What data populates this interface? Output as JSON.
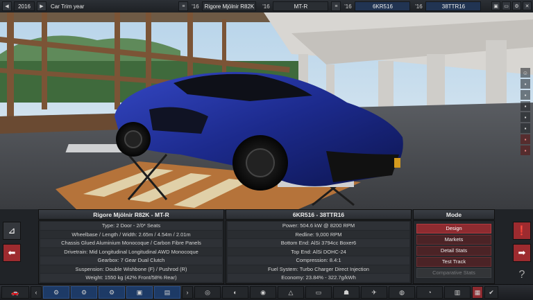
{
  "topbar": {
    "year": "2016",
    "trim_label": "Car Trim year",
    "model_year": "'16",
    "model_name": "Rigore Mjölnir R82K",
    "trim_year": "'16",
    "trim_name": "MT-R",
    "engine_year": "'16",
    "engine_name": "6KR516",
    "variant_year": "'16",
    "variant_name": "38TTR16"
  },
  "specs_left": {
    "header": "Rigore Mjölnir R82K - MT-R",
    "rows": [
      "Type: 2 Door - 2/0* Seats",
      "Wheelbase / Length / Width: 2.65m / 4.54m / 2.01m",
      "Chassis Glued Aluminium Monocoque / Carbon Fibre Panels",
      "Drivetrain: Mid Longitudinal Longitudinal AWD Monocoque",
      "Gearbox: 7 Gear Dual Clutch",
      "Suspension: Double Wishbone (F) / Pushrod (R)",
      "Weight: 1550 kg (42% Front/58% Rear)"
    ]
  },
  "specs_right": {
    "header": "6KR516 - 38TTR16",
    "rows": [
      "Power: 504.6 kW @ 8200 RPM",
      "Redline:  9,000 RPM",
      "Bottom End: AlSi 3794cc Boxer6",
      "Top End: AlSi DOHC-24",
      "Compression: 8.4:1",
      "Fuel System: Turbo Charger Direct Injection",
      "Economy: 23.84% - 322.7g/kWh"
    ]
  },
  "mode": {
    "header": "Mode",
    "buttons": [
      "Design",
      "Markets",
      "Detail Stats",
      "Test Track",
      "Comparative Stats"
    ]
  },
  "colors": {
    "accent_red": "#8e2b30",
    "accent_blue": "#213452",
    "car_paint": "#1c2a8c"
  }
}
